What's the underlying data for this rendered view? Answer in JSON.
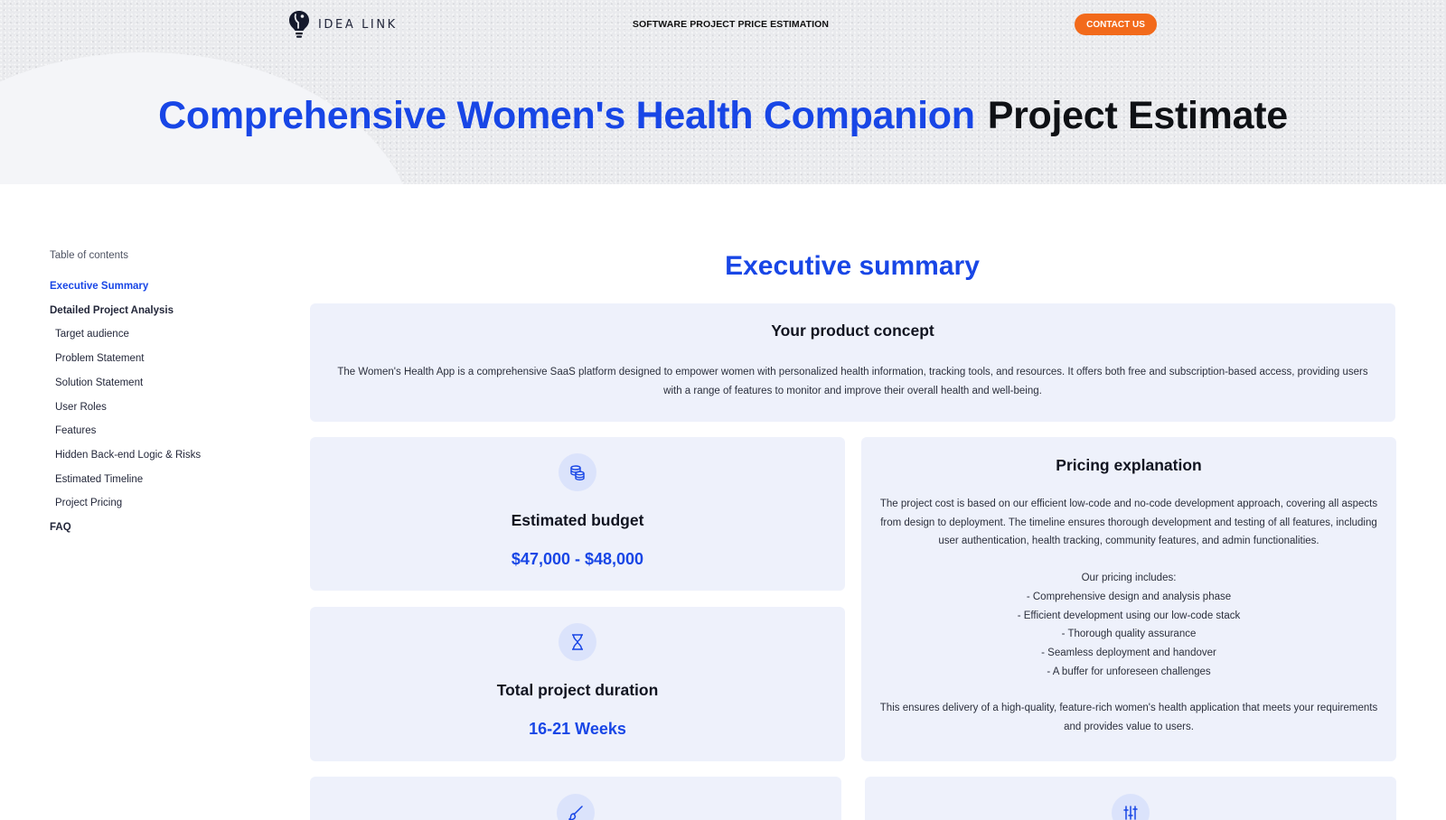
{
  "header": {
    "logo_text": "IDEA LINK",
    "title": "SOFTWARE PROJECT PRICE ESTIMATION",
    "contact_label": "CONTACT US"
  },
  "hero": {
    "title_highlight": "Comprehensive Women's Health Companion",
    "title_rest": "Project Estimate"
  },
  "toc": {
    "title": "Table of contents",
    "items": [
      {
        "label": "Executive Summary",
        "level": "top",
        "active": true
      },
      {
        "label": "Detailed Project Analysis",
        "level": "top"
      },
      {
        "label": "Target audience",
        "level": "sub"
      },
      {
        "label": "Problem Statement",
        "level": "sub"
      },
      {
        "label": "Solution Statement",
        "level": "sub"
      },
      {
        "label": "User Roles",
        "level": "sub"
      },
      {
        "label": "Features",
        "level": "sub"
      },
      {
        "label": "Hidden Back-end Logic & Risks",
        "level": "sub"
      },
      {
        "label": "Estimated Timeline",
        "level": "sub"
      },
      {
        "label": "Project Pricing",
        "level": "sub"
      },
      {
        "label": "FAQ",
        "level": "top"
      }
    ]
  },
  "summary": {
    "title": "Executive summary",
    "concept": {
      "title": "Your product concept",
      "text": "The Women's Health App is a comprehensive SaaS platform designed to empower women with personalized health information, tracking tools, and resources. It offers both free and subscription-based access, providing users with a range of features to monitor and improve their overall health and well-being."
    },
    "budget": {
      "title": "Estimated budget",
      "value": "$47,000 - $48,000",
      "icon": "coins-icon"
    },
    "duration": {
      "title": "Total project duration",
      "value": "16-21 Weeks",
      "icon": "hourglass-icon"
    },
    "pricing": {
      "title": "Pricing explanation",
      "intro": "The project cost is based on our efficient low-code and no-code development approach, covering all aspects from design to deployment. The timeline ensures thorough development and testing of all features, including user authentication, health tracking, community features, and admin functionalities.",
      "list_title": "Our pricing includes:",
      "list": [
        "- Comprehensive design and analysis phase",
        "- Efficient development using our low-code stack",
        "- Thorough quality assurance",
        "- Seamless deployment and handover",
        "- A buffer for unforeseen challenges"
      ],
      "footer": "This ensures delivery of a high-quality, feature-rich women's health application that meets your requirements and provides value to users."
    },
    "bottom_icons": [
      "brush-icon",
      "sliders-icon"
    ]
  },
  "colors": {
    "accent": "#1846e6",
    "cta": "#f26a1b",
    "card_bg": "#eef1fb",
    "icon_bg": "#dbe3fb"
  }
}
